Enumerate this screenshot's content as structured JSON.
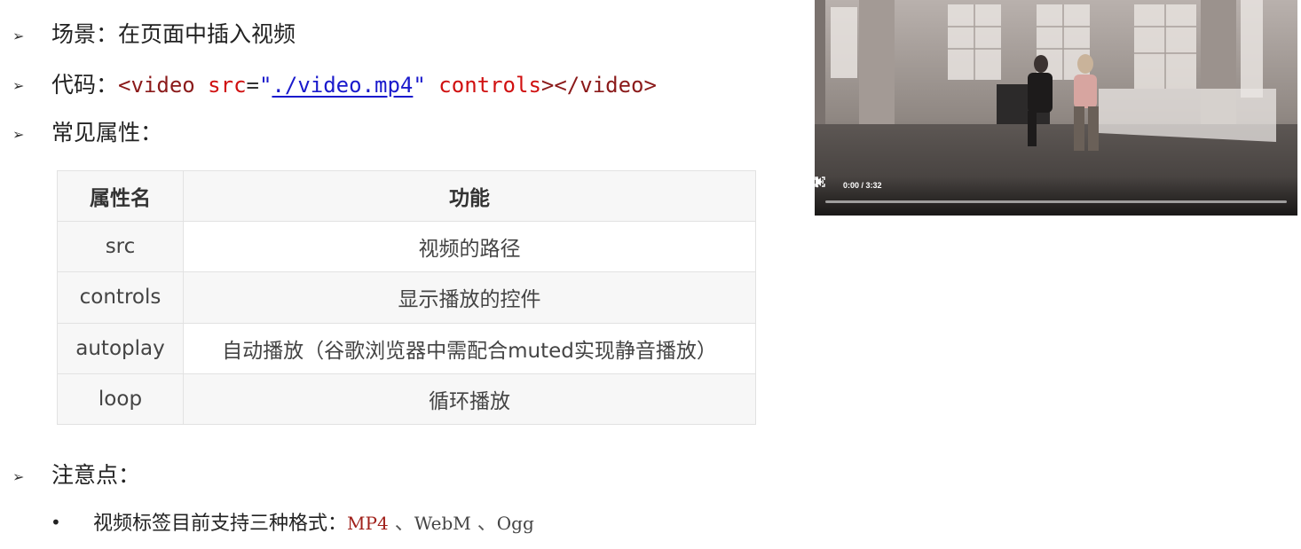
{
  "bullets": [
    {
      "label": "场景：",
      "text": "在页面中插入视频"
    },
    {
      "label": "代码："
    },
    {
      "label": "常见属性："
    },
    {
      "label": "注意点："
    }
  ],
  "code": {
    "open_tag": "<video",
    "src_attr": "src",
    "eq": "=",
    "quote": "\"",
    "path": "./video.mp4",
    "controls_attr": "controls",
    "close_tags": "></video>"
  },
  "table": {
    "headers": [
      "属性名",
      "功能"
    ],
    "rows": [
      [
        "src",
        "视频的路径"
      ],
      [
        "controls",
        "显示播放的控件"
      ],
      [
        "autoplay",
        "自动播放（谷歌浏览器中需配合muted实现静音播放）"
      ],
      [
        "loop",
        "循环播放"
      ]
    ]
  },
  "note": {
    "bullet": "•",
    "text": "视频标签目前支持三种格式：",
    "formats": [
      "MP4",
      "WebM",
      "Ogg"
    ],
    "separator": "、"
  },
  "video_player": {
    "time": "0:00 / 3:32",
    "progress": 0,
    "icons": [
      "play-icon",
      "volume-icon",
      "fullscreen-icon",
      "more-options-icon"
    ]
  }
}
